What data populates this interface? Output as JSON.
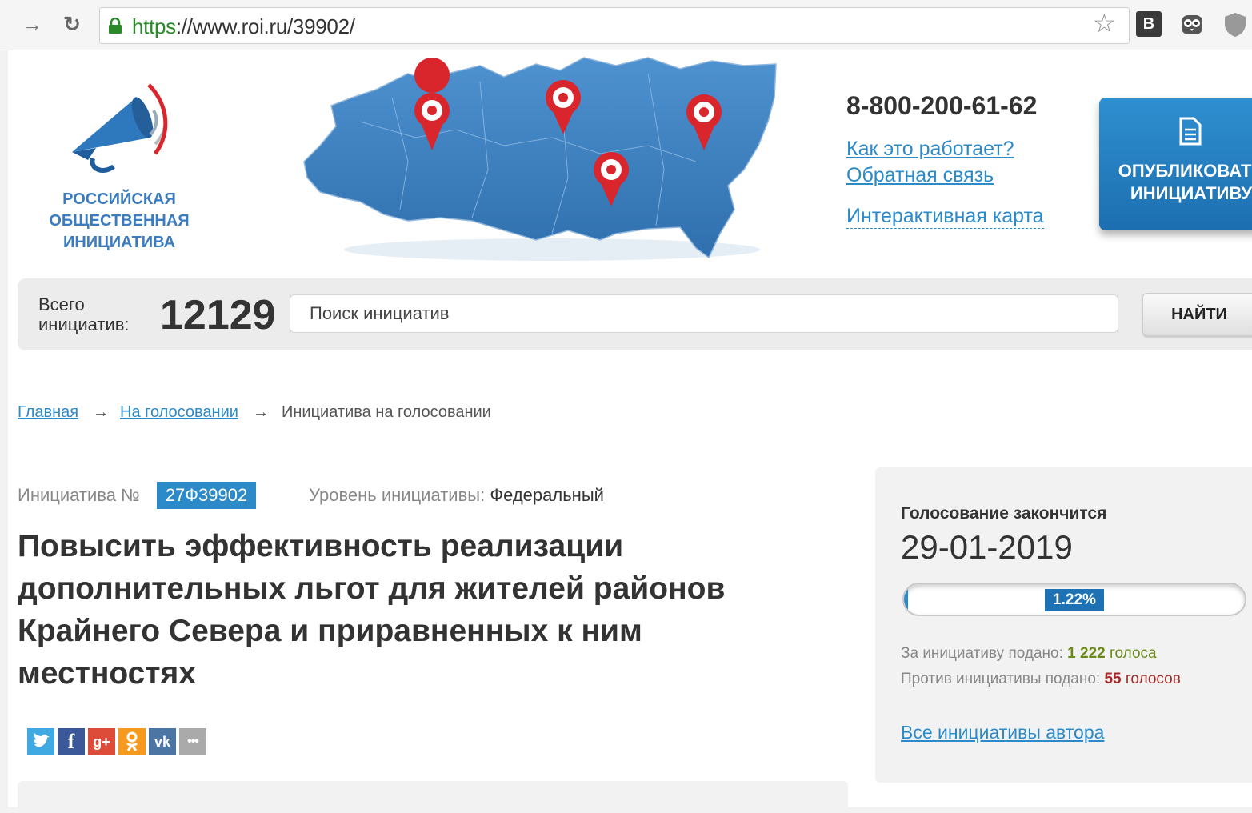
{
  "browser": {
    "url_protocol": "https",
    "url_rest": "://www.roi.ru/39902/"
  },
  "header": {
    "logo_line1": "РОССИЙСКАЯ",
    "logo_line2": "ОБЩЕСТВЕННАЯ",
    "logo_line3": "ИНИЦИАТИВА",
    "phone": "8-800-200-61-62",
    "links": [
      "Как это работает?",
      "Обратная связь",
      "Интерактивная карта"
    ],
    "publish_line1": "ОПУБЛИКОВАТЬ",
    "publish_line2": "ИНИЦИАТИВУ"
  },
  "search": {
    "total_label_1": "Всего",
    "total_label_2": "инициатив:",
    "total_count": "12129",
    "placeholder": "Поиск инициатив",
    "button": "НАЙТИ"
  },
  "breadcrumb": {
    "home": "Главная",
    "section": "На голосовании",
    "arrow": "→",
    "current": "Инициатива на голосовании"
  },
  "initiative": {
    "number_label": "Инициатива №",
    "number": "27Ф39902",
    "level_label": "Уровень инициативы:",
    "level": "Федеральный",
    "title": "Повысить эффективность реализации дополнительных льгот для жителей районов Крайнего Севера и приравненных к ним местностях"
  },
  "share_icons": [
    "twitter-icon",
    "facebook-icon",
    "google-plus-icon",
    "odnoklassniki-icon",
    "vk-icon",
    "more-icon"
  ],
  "vote": {
    "ends_label": "Голосование закончится",
    "ends_date": "29-01-2019",
    "progress_percent": 1.22,
    "progress_text": "1.22%",
    "for_label": "За инициативу подано:",
    "for_count": "1 222",
    "for_word": "голоса",
    "against_label": "Против инициативы подано:",
    "against_count": "55",
    "against_word": "голосов",
    "author_link": "Все инициативы автора"
  },
  "colors": {
    "brand_blue": "#2c8ac9",
    "for_green": "#6a8a1a",
    "against_red": "#a52a2a"
  }
}
